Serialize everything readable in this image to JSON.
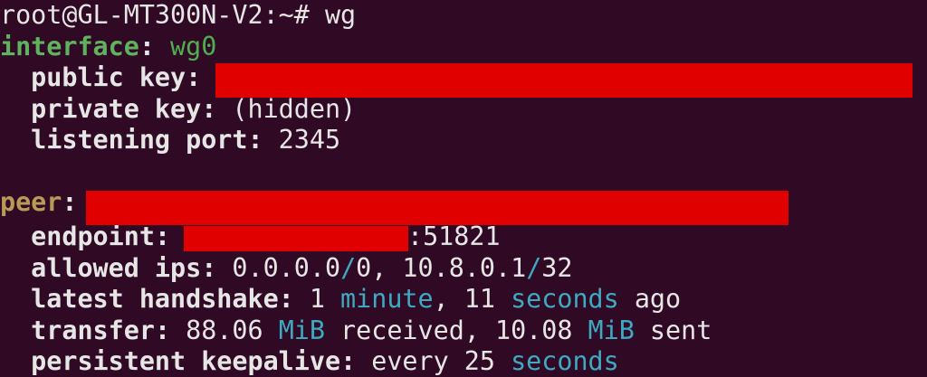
{
  "window": {
    "background": "#300a24"
  },
  "prompt": {
    "text": "root@GL-MT300N-V2:~# ",
    "command": "wg"
  },
  "interface": {
    "label": "interface",
    "sep": ":",
    "name": " wg0"
  },
  "public_key": {
    "label": "  public key",
    "sep": ":"
  },
  "private_key": {
    "label": "  private key",
    "sep": ":",
    "value": " (hidden)"
  },
  "listening_port": {
    "label": "  listening port",
    "sep": ":",
    "value": " 2345"
  },
  "peer": {
    "label": "peer",
    "sep": ":"
  },
  "endpoint": {
    "label": "  endpoint",
    "sep": ":",
    "port": ":51821"
  },
  "allowed_ips": {
    "label": "  allowed ips",
    "sep": ":",
    "v1": " 0.0.0.0",
    "slash1": "/",
    "v2": "0, 10.8.0.1",
    "slash2": "/",
    "v3": "32"
  },
  "handshake": {
    "label": "  latest handshake",
    "sep": ":",
    "n1": " 1 ",
    "u1": "minute",
    "n2": ", 11 ",
    "u2": "seconds",
    "tail": " ago"
  },
  "transfer": {
    "label": "  transfer",
    "sep": ":",
    "n1": " 88.06 ",
    "u1": "MiB",
    "t1": " received, 10.08 ",
    "u2": "MiB",
    "t2": " sent"
  },
  "keepalive": {
    "label": "  persistent keepalive",
    "sep": ":",
    "n1": " every 25 ",
    "u1": "seconds"
  },
  "colors": {
    "text": "#e6e6e6",
    "interface": "#5fb35f",
    "peer": "#b89a57",
    "unit": "#3fa9c2",
    "redaction": "#e00000"
  }
}
